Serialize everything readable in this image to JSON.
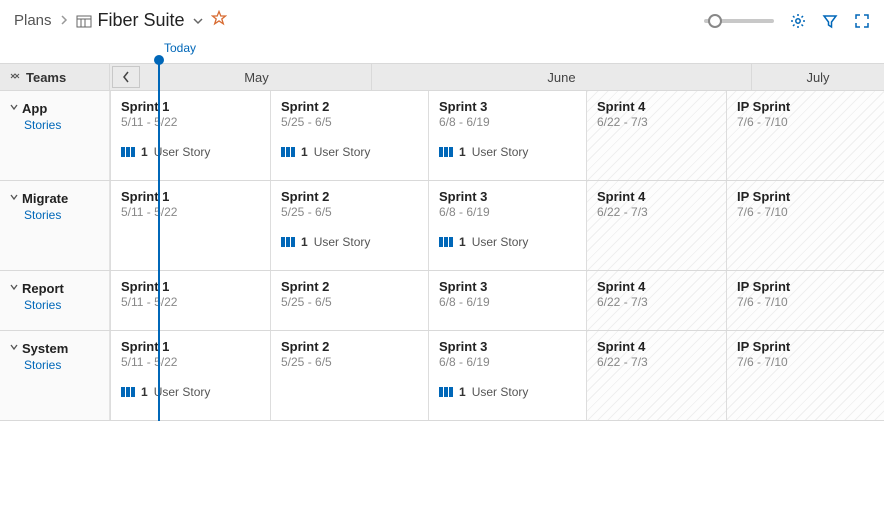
{
  "header": {
    "breadcrumb": "Plans",
    "plan_name": "Fiber Suite"
  },
  "today_label": "Today",
  "teams_header": "Teams",
  "months": [
    "May",
    "June",
    "July"
  ],
  "month_widths": [
    "230px",
    "380px",
    "136px"
  ],
  "story_label": "User Story",
  "teams": [
    {
      "name": "App",
      "sublink": "Stories",
      "sprints": [
        {
          "title": "Sprint 1",
          "dates": "5/11 - 5/22",
          "stories": 1
        },
        {
          "title": "Sprint 2",
          "dates": "5/25 - 6/5",
          "stories": 1
        },
        {
          "title": "Sprint 3",
          "dates": "6/8 - 6/19",
          "stories": 1
        },
        {
          "title": "Sprint 4",
          "dates": "6/22 - 7/3",
          "stories": 0,
          "hatched": true
        },
        {
          "title": "IP Sprint",
          "dates": "7/6 - 7/10",
          "stories": 0,
          "hatched": true
        }
      ]
    },
    {
      "name": "Migrate",
      "sublink": "Stories",
      "sprints": [
        {
          "title": "Sprint 1",
          "dates": "5/11 - 5/22",
          "stories": 0
        },
        {
          "title": "Sprint 2",
          "dates": "5/25 - 6/5",
          "stories": 1
        },
        {
          "title": "Sprint 3",
          "dates": "6/8 - 6/19",
          "stories": 1
        },
        {
          "title": "Sprint 4",
          "dates": "6/22 - 7/3",
          "stories": 0,
          "hatched": true
        },
        {
          "title": "IP Sprint",
          "dates": "7/6 - 7/10",
          "stories": 0,
          "hatched": true
        }
      ]
    },
    {
      "name": "Report",
      "sublink": "Stories",
      "short": true,
      "sprints": [
        {
          "title": "Sprint 1",
          "dates": "5/11 - 5/22",
          "stories": 0
        },
        {
          "title": "Sprint 2",
          "dates": "5/25 - 6/5",
          "stories": 0
        },
        {
          "title": "Sprint 3",
          "dates": "6/8 - 6/19",
          "stories": 0
        },
        {
          "title": "Sprint 4",
          "dates": "6/22 - 7/3",
          "stories": 0,
          "hatched": true
        },
        {
          "title": "IP Sprint",
          "dates": "7/6 - 7/10",
          "stories": 0,
          "hatched": true
        }
      ]
    },
    {
      "name": "System",
      "sublink": "Stories",
      "sprints": [
        {
          "title": "Sprint 1",
          "dates": "5/11 - 5/22",
          "stories": 1
        },
        {
          "title": "Sprint 2",
          "dates": "5/25 - 6/5",
          "stories": 0
        },
        {
          "title": "Sprint 3",
          "dates": "6/8 - 6/19",
          "stories": 1
        },
        {
          "title": "Sprint 4",
          "dates": "6/22 - 7/3",
          "stories": 0,
          "hatched": true
        },
        {
          "title": "IP Sprint",
          "dates": "7/6 - 7/10",
          "stories": 0,
          "hatched": true
        }
      ]
    }
  ]
}
